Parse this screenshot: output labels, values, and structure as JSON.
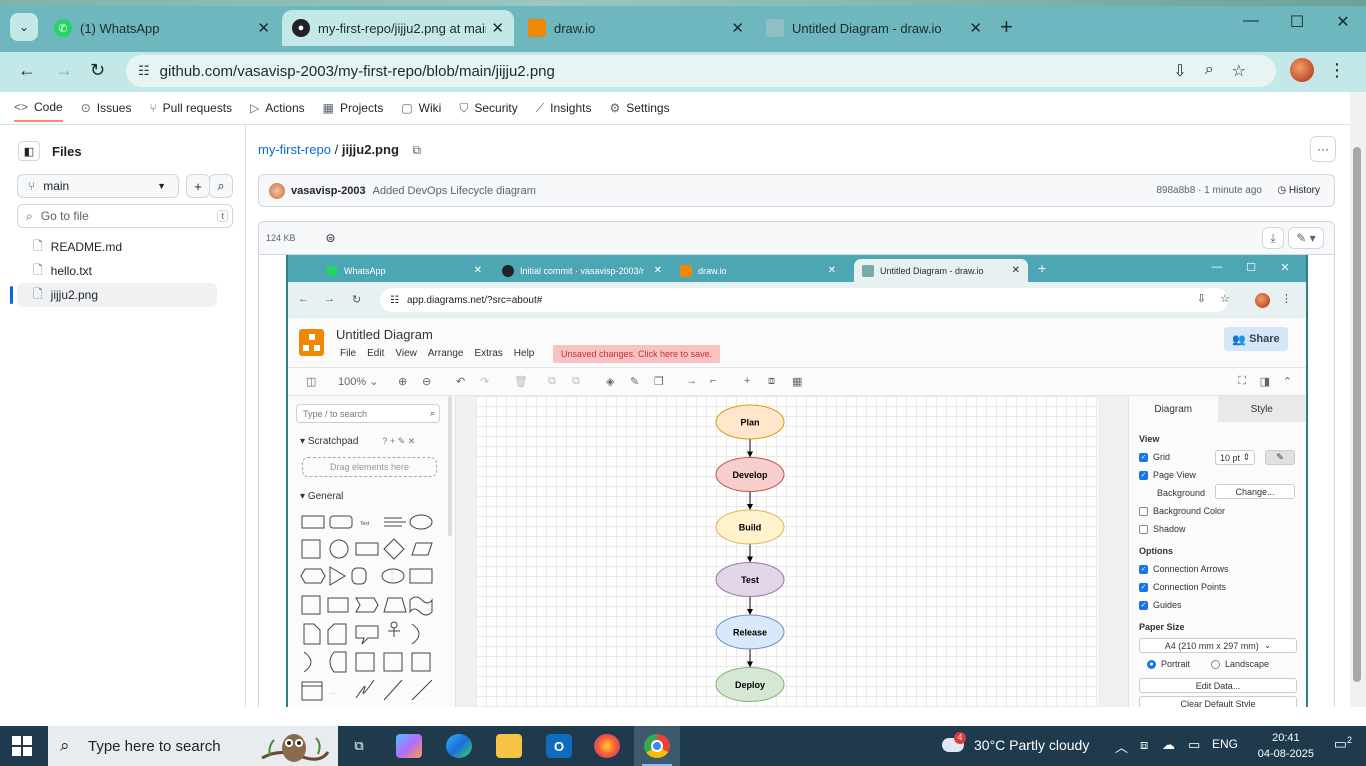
{
  "browser": {
    "tabs": [
      {
        "title": "(1) WhatsApp",
        "icon": "whatsapp-icon"
      },
      {
        "title": "my-first-repo/jijju2.png at main",
        "icon": "github-icon"
      },
      {
        "title": "draw.io",
        "icon": "drawio-icon"
      },
      {
        "title": "Untitled Diagram - draw.io",
        "icon": "drawio-icon"
      }
    ],
    "url": "github.com/vasavisp-2003/my-first-repo/blob/main/jijju2.png"
  },
  "repo_nav": [
    {
      "label": "Code",
      "icon": "code-icon"
    },
    {
      "label": "Issues",
      "icon": "issues-icon"
    },
    {
      "label": "Pull requests",
      "icon": "pull-request-icon"
    },
    {
      "label": "Actions",
      "icon": "actions-icon"
    },
    {
      "label": "Projects",
      "icon": "projects-icon"
    },
    {
      "label": "Wiki",
      "icon": "wiki-icon"
    },
    {
      "label": "Security",
      "icon": "shield-icon"
    },
    {
      "label": "Insights",
      "icon": "graph-icon"
    },
    {
      "label": "Settings",
      "icon": "gear-icon"
    }
  ],
  "sidebar": {
    "title": "Files",
    "branch": "main",
    "goto_placeholder": "Go to file",
    "goto_kbd": "t",
    "files": [
      "README.md",
      "hello.txt",
      "jijju2.png"
    ]
  },
  "file": {
    "repo": "my-first-repo",
    "separator": "/",
    "name": "jijju2.png",
    "author": "vasavisp-2003",
    "commit_message": "Added DevOps Lifecycle diagram",
    "sha_time": "898a8b8 · 1 minute ago",
    "history": "History",
    "size": "124 KB"
  },
  "embedded": {
    "tabs": [
      "WhatsApp",
      "Initial commit · vasavisp-2003/r",
      "draw.io",
      "Untitled Diagram - draw.io"
    ],
    "url": "app.diagrams.net/?src=about#",
    "title": "Untitled Diagram",
    "menu": [
      "File",
      "Edit",
      "View",
      "Arrange",
      "Extras",
      "Help"
    ],
    "unsaved": "Unsaved changes. Click here to save.",
    "share": "Share",
    "zoom": "100%",
    "search_placeholder": "Type / to search",
    "scratchpad": "Scratchpad",
    "drag_here": "Drag elements here",
    "general": "General",
    "flow": [
      "Plan",
      "Develop",
      "Build",
      "Test",
      "Release",
      "Deploy"
    ],
    "flow_colors": [
      {
        "fill": "#ffe6cc",
        "stroke": "#d79b00"
      },
      {
        "fill": "#f8cecc",
        "stroke": "#b85450"
      },
      {
        "fill": "#fff2cc",
        "stroke": "#d6b656"
      },
      {
        "fill": "#e1d5e7",
        "stroke": "#9673a6"
      },
      {
        "fill": "#dae8fc",
        "stroke": "#6c8ebf"
      },
      {
        "fill": "#d5e8d4",
        "stroke": "#82b366"
      }
    ],
    "format": {
      "tab_diagram": "Diagram",
      "tab_style": "Style",
      "view": "View",
      "grid": "Grid",
      "grid_size": "10 pt",
      "page_view": "Page View",
      "background": "Background",
      "change": "Change...",
      "background_color": "Background Color",
      "shadow": "Shadow",
      "options": "Options",
      "connection_arrows": "Connection Arrows",
      "connection_points": "Connection Points",
      "guides": "Guides",
      "paper_size": "Paper Size",
      "paper_value": "A4 (210 mm x 297 mm)",
      "portrait": "Portrait",
      "landscape": "Landscape",
      "edit_data": "Edit Data...",
      "clear_default": "Clear Default Style"
    }
  },
  "taskbar": {
    "search_placeholder": "Type here to search",
    "weather": "30°C  Partly cloudy",
    "weather_badge": "4",
    "lang": "ENG",
    "time": "20:41",
    "date": "04-08-2025",
    "notif_count": "2"
  }
}
